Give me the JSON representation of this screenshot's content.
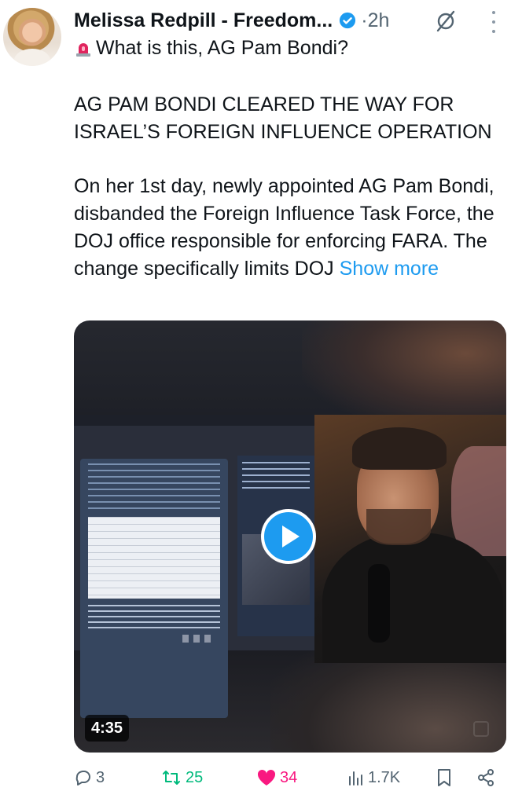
{
  "post": {
    "author": "Melissa Redpill - Freedom...",
    "time": "2h",
    "line1": "What is this, AG Pam Bondi?",
    "headline": "AG PAM BONDI CLEARED THE WAY FOR ISRAEL’S FOREIGN INFLUENCE OPERATION",
    "body": "On her 1st day, newly appointed AG Pam Bondi, disbanded the Foreign Influence Task Force, the DOJ office responsible for enforcing FARA. The change specifically limits DOJ",
    "show_more": "Show more"
  },
  "media": {
    "duration": "4:35"
  },
  "actions": {
    "replies": "3",
    "reposts": "25",
    "likes": "34",
    "views": "1.7K"
  },
  "colors": {
    "accent": "#1d9bf0",
    "like": "#f91880",
    "repost": "#00ba7c",
    "secondary": "#536471"
  },
  "icons": [
    "verified-badge-icon",
    "grok-icon",
    "more-options-icon",
    "siren-emoji-icon",
    "play-icon",
    "reply-icon",
    "repost-icon",
    "heart-icon",
    "views-icon",
    "bookmark-icon",
    "share-icon"
  ]
}
